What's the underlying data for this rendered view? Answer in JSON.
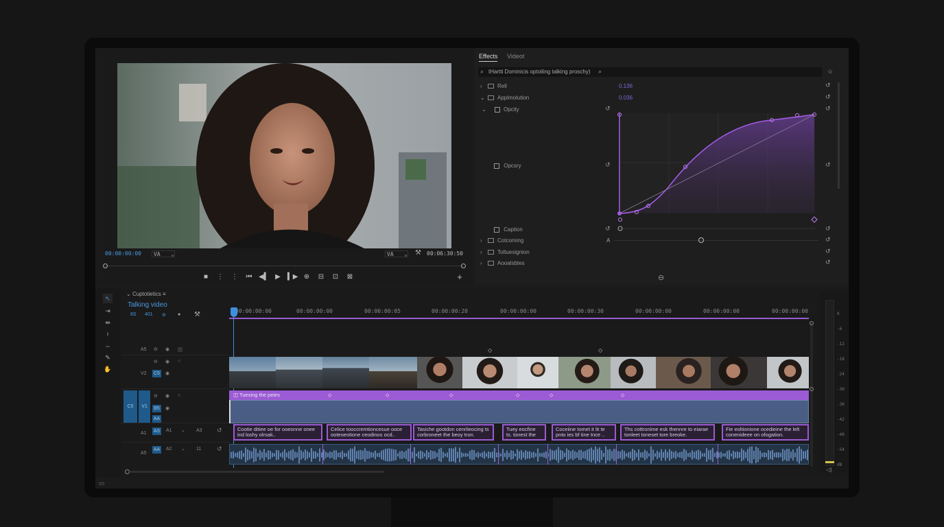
{
  "program": {
    "timecode_in": "00:00:00:00",
    "fit_label": "VA",
    "fit_label_right": "VA",
    "timecode_out": "00:06:30:50",
    "transport": [
      {
        "name": "stop-icon",
        "glyph": "■"
      },
      {
        "name": "mark-in-icon",
        "glyph": "⋮"
      },
      {
        "name": "mark-out-icon",
        "glyph": "⋮"
      },
      {
        "name": "go-to-in-icon",
        "glyph": "⏮"
      },
      {
        "name": "step-back-icon",
        "glyph": "◀▍"
      },
      {
        "name": "play-icon",
        "glyph": "▶"
      },
      {
        "name": "step-forward-icon",
        "glyph": "▍▶"
      },
      {
        "name": "insert-icon",
        "glyph": "⊕"
      },
      {
        "name": "overwrite-icon",
        "glyph": "⊟"
      },
      {
        "name": "lift-icon",
        "glyph": "⊡"
      },
      {
        "name": "export-frame-icon",
        "glyph": "⊠"
      }
    ],
    "add_button": "+"
  },
  "effects": {
    "tabs": [
      "Effects",
      "Videot"
    ],
    "search_value": "tHartti Dominicis optoiling talking proschy)",
    "rows": [
      {
        "label": "Rell",
        "value": "0.136"
      },
      {
        "label": "Applmolution",
        "value": "0.036"
      },
      {
        "label": "Opcity",
        "value": ""
      },
      {
        "label": "Opcsry",
        "value": ""
      },
      {
        "label": "Caption",
        "value": ""
      },
      {
        "label": "Cotcoming",
        "value": ""
      },
      {
        "label": "Toltuesignion",
        "value": ""
      },
      {
        "label": "Aooalsbtes",
        "value": ""
      }
    ],
    "footer_icon": "⊖"
  },
  "timeline": {
    "panel_label": "Cuptotietics",
    "sequence_name": "Talking video",
    "seq_toggles": [
      "8S",
      "401",
      "⊘",
      "●"
    ],
    "ruler": [
      "00:00:00:00",
      "00:00:00:00",
      "00:00:00:05",
      "00:00:00:20",
      "00:00:00:00",
      "00:00:00:30",
      "00:00:00:00",
      "00:00:00:00",
      "00:00:00:00"
    ],
    "video_clip_label": "Tuesing the peies",
    "captions": [
      "Cootie ditiee oe for ooeonne onee ind loshy olrsak..",
      "Celice tooccremtioncesue ooce ooteoeotione ceodinos ocd..",
      "Tasiche gootdon cenrlieocing ts corbroneet the beoy tron.",
      "Tuey eocfine ts. tonest the tonn.",
      "Coceiine tomet it lit te pnto ies bf tine tnce ..",
      "Ths cottronime esk thennre to eiarae tonleet toneset tore breoke.",
      "Fie eoltionione ocedieine the lelt conenideee on ofogation."
    ],
    "tracks": {
      "v3": "A5",
      "v2": "V2",
      "v2_badge": "C5",
      "v1": "V1",
      "v1_src": "C5",
      "v1_badge1": "B5",
      "v1_badge2": "AA",
      "a1_src": "A1",
      "a1": "A1",
      "a1_badge": "AS",
      "a1_num": "A3",
      "a2_src": "A5",
      "a2": "A2",
      "a2_badge": "AA",
      "a2_num": "11"
    },
    "meter_labels": [
      "0",
      "-6",
      "-12",
      "-18",
      "-24",
      "-30",
      "-36",
      "-42",
      "-48",
      "-54",
      "dB"
    ]
  },
  "colors": {
    "accent_purple": "#9b5bd4",
    "playhead_blue": "#3d8fe0",
    "timecode_blue": "#4a9ae0",
    "audio_wave": "#6f95c9"
  }
}
